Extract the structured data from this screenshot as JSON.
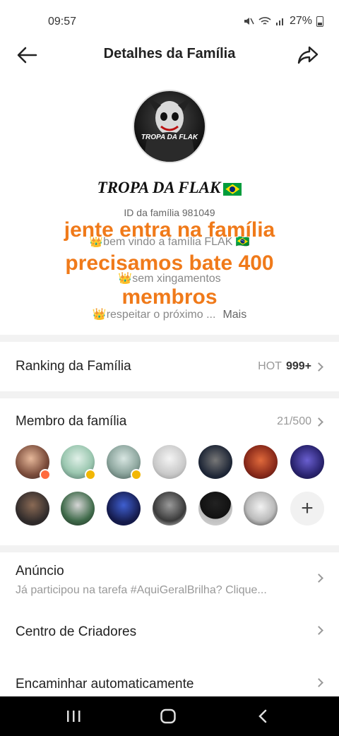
{
  "status": {
    "time": "09:57",
    "battery": "27%"
  },
  "header": {
    "title": "Detalhes da Família"
  },
  "family": {
    "avatar_text": "TROPA DA FLAK",
    "name": "TROPA DA FLAK",
    "id_text": "ID da família 981049",
    "description": [
      "👑bem vindo a família FLAK 🇧🇷",
      "👑sem xingamentos",
      "👑respeitar o próximo ..."
    ],
    "more_label": "Mais"
  },
  "overlay": {
    "lines": [
      "jente entra na família",
      "precisamos bate 400",
      "membros"
    ],
    "color": "#f07a1a"
  },
  "ranking": {
    "label": "Ranking da Família",
    "hot_prefix": "HOT",
    "hot_value": "999+"
  },
  "members": {
    "label": "Membro da família",
    "count": "21/500"
  },
  "announcement": {
    "label": "Anúncio",
    "text": "Já participou na tarefa #AquiGeralBrilha? Clique..."
  },
  "creator_center": {
    "label": "Centro de Criadores"
  },
  "auto_forward": {
    "label": "Encaminhar automaticamente"
  },
  "colors": {
    "divider": "#f2f2f2",
    "nav_bar": "#000000"
  }
}
